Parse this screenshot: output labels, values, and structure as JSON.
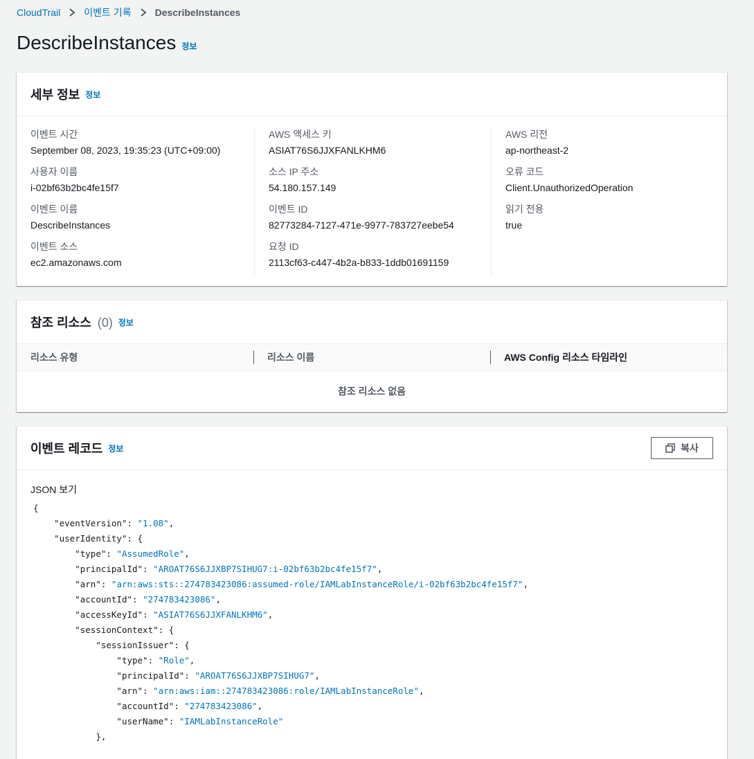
{
  "breadcrumb": {
    "items": [
      "CloudTrail",
      "이벤트 기록"
    ],
    "current": "DescribeInstances"
  },
  "page": {
    "title": "DescribeInstances",
    "info_label": "정보"
  },
  "details": {
    "title": "세부 정보",
    "info_label": "정보",
    "columns": [
      [
        {
          "label": "이벤트 시간",
          "value": "September 08, 2023, 19:35:23 (UTC+09:00)"
        },
        {
          "label": "사용자 이름",
          "value": "i-02bf63b2bc4fe15f7"
        },
        {
          "label": "이벤트 이름",
          "value": "DescribeInstances"
        },
        {
          "label": "이벤트 소스",
          "value": "ec2.amazonaws.com"
        }
      ],
      [
        {
          "label": "AWS 액세스 키",
          "value": "ASIAT76S6JJXFANLKHM6"
        },
        {
          "label": "소스 IP 주소",
          "value": "54.180.157.149"
        },
        {
          "label": "이벤트 ID",
          "value": "82773284-7127-471e-9977-783727eebe54"
        },
        {
          "label": "요청 ID",
          "value": "2113cf63-c447-4b2a-b833-1ddb01691159"
        }
      ],
      [
        {
          "label": "AWS 리전",
          "value": "ap-northeast-2"
        },
        {
          "label": "오류 코드",
          "value": "Client.UnauthorizedOperation"
        },
        {
          "label": "읽기 전용",
          "value": "true"
        }
      ]
    ]
  },
  "references": {
    "title": "참조 리소스",
    "count": "(0)",
    "info_label": "정보",
    "columns": [
      "리소스 유형",
      "리소스 이름",
      "AWS Config 리소스 타임라인"
    ],
    "empty_text": "참조 리소스 없음"
  },
  "record": {
    "title": "이벤트 레코드",
    "info_label": "정보",
    "copy_label": "복사",
    "json_label": "JSON 보기",
    "lines": [
      {
        "indent": 0,
        "key": "",
        "value": "",
        "tail": "{"
      },
      {
        "indent": 1,
        "key": "\"eventVersion\"",
        "value": "\"1.08\"",
        "tail": ","
      },
      {
        "indent": 1,
        "key": "\"userIdentity\"",
        "value": "",
        "tail": ": {"
      },
      {
        "indent": 2,
        "key": "\"type\"",
        "value": "\"AssumedRole\"",
        "tail": ","
      },
      {
        "indent": 2,
        "key": "\"principalId\"",
        "value": "\"AROAT76S6JJXBP7SIHUG7:i-02bf63b2bc4fe15f7\"",
        "tail": ","
      },
      {
        "indent": 2,
        "key": "\"arn\"",
        "value": "\"arn:aws:sts::274783423086:assumed-role/IAMLabInstanceRole/i-02bf63b2bc4fe15f7\"",
        "tail": ","
      },
      {
        "indent": 2,
        "key": "\"accountId\"",
        "value": "\"274783423086\"",
        "tail": ","
      },
      {
        "indent": 2,
        "key": "\"accessKeyId\"",
        "value": "\"ASIAT76S6JJXFANLKHM6\"",
        "tail": ","
      },
      {
        "indent": 2,
        "key": "\"sessionContext\"",
        "value": "",
        "tail": ": {"
      },
      {
        "indent": 3,
        "key": "\"sessionIssuer\"",
        "value": "",
        "tail": ": {"
      },
      {
        "indent": 4,
        "key": "\"type\"",
        "value": "\"Role\"",
        "tail": ","
      },
      {
        "indent": 4,
        "key": "\"principalId\"",
        "value": "\"AROAT76S6JJXBP7SIHUG7\"",
        "tail": ","
      },
      {
        "indent": 4,
        "key": "\"arn\"",
        "value": "\"arn:aws:iam::274783423086:role/IAMLabInstanceRole\"",
        "tail": ","
      },
      {
        "indent": 4,
        "key": "\"accountId\"",
        "value": "\"274783423086\"",
        "tail": ","
      },
      {
        "indent": 4,
        "key": "\"userName\"",
        "value": "\"IAMLabInstanceRole\"",
        "tail": ""
      },
      {
        "indent": 3,
        "key": "",
        "value": "",
        "tail": "},"
      }
    ]
  },
  "icons": {
    "breadcrumb_separator": "chevron-right-icon",
    "copy": "copy-icon"
  },
  "colors": {
    "link": "#0073bb",
    "background": "#f2f3f3",
    "text": "#16191f",
    "muted": "#545b64"
  }
}
